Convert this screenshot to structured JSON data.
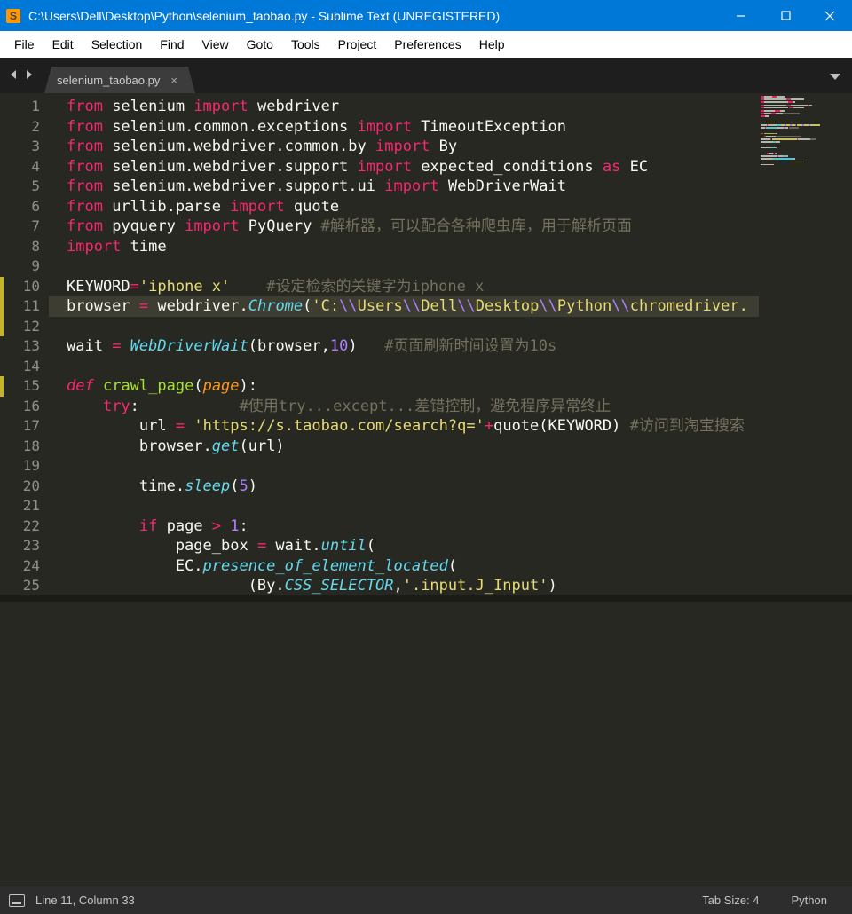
{
  "window": {
    "title": "C:\\Users\\Dell\\Desktop\\Python\\selenium_taobao.py - Sublime Text (UNREGISTERED)"
  },
  "menu": {
    "items": [
      "File",
      "Edit",
      "Selection",
      "Find",
      "View",
      "Goto",
      "Tools",
      "Project",
      "Preferences",
      "Help"
    ]
  },
  "tabs": {
    "active": {
      "label": "selenium_taobao.py",
      "close": "×"
    }
  },
  "editor": {
    "modified_lines": [
      10,
      11,
      12,
      15
    ],
    "current_line": 11,
    "lines": [
      {
        "n": 1,
        "tokens": [
          [
            "from",
            "c-kw"
          ],
          [
            " selenium ",
            ""
          ],
          [
            "import",
            "c-kw"
          ],
          [
            " webdriver",
            ""
          ]
        ]
      },
      {
        "n": 2,
        "tokens": [
          [
            "from",
            "c-kw"
          ],
          [
            " selenium.common.exceptions ",
            ""
          ],
          [
            "import",
            "c-kw"
          ],
          [
            " TimeoutException",
            ""
          ]
        ]
      },
      {
        "n": 3,
        "tokens": [
          [
            "from",
            "c-kw"
          ],
          [
            " selenium.webdriver.common.by ",
            ""
          ],
          [
            "import",
            "c-kw"
          ],
          [
            " By",
            ""
          ]
        ]
      },
      {
        "n": 4,
        "tokens": [
          [
            "from",
            "c-kw"
          ],
          [
            " selenium.webdriver.support ",
            ""
          ],
          [
            "import",
            "c-kw"
          ],
          [
            " expected_conditions ",
            ""
          ],
          [
            "as",
            "c-kw"
          ],
          [
            " EC",
            ""
          ]
        ]
      },
      {
        "n": 5,
        "tokens": [
          [
            "from",
            "c-kw"
          ],
          [
            " selenium.webdriver.support.ui ",
            ""
          ],
          [
            "import",
            "c-kw"
          ],
          [
            " WebDriverWait",
            ""
          ]
        ]
      },
      {
        "n": 6,
        "tokens": [
          [
            "from",
            "c-kw"
          ],
          [
            " urllib.parse ",
            ""
          ],
          [
            "import",
            "c-kw"
          ],
          [
            " quote",
            ""
          ]
        ]
      },
      {
        "n": 7,
        "tokens": [
          [
            "from",
            "c-kw"
          ],
          [
            " pyquery ",
            ""
          ],
          [
            "import",
            "c-kw"
          ],
          [
            " PyQuery ",
            ""
          ],
          [
            "#解析器，可以配合各种爬虫库，用于解析页面",
            "c-com"
          ]
        ]
      },
      {
        "n": 8,
        "tokens": [
          [
            "import",
            "c-kw"
          ],
          [
            " time",
            ""
          ]
        ]
      },
      {
        "n": 9,
        "tokens": [
          [
            "",
            ""
          ]
        ]
      },
      {
        "n": 10,
        "tokens": [
          [
            "KEYWORD",
            ""
          ],
          [
            "=",
            "c-op"
          ],
          [
            "'iphone x'",
            "c-str"
          ],
          [
            "    ",
            ""
          ],
          [
            "#设定检索的关键字为iphone x",
            "c-com"
          ]
        ]
      },
      {
        "n": 11,
        "tokens": [
          [
            "browser ",
            ""
          ],
          [
            "=",
            "c-op"
          ],
          [
            " webdriver.",
            ""
          ],
          [
            "Chrome",
            "c-fn"
          ],
          [
            "(",
            ""
          ],
          [
            "'C:",
            "c-str"
          ],
          [
            "\\\\",
            "c-num"
          ],
          [
            "Users",
            "c-str"
          ],
          [
            "\\\\",
            "c-num"
          ],
          [
            "Dell",
            "c-str"
          ],
          [
            "\\\\",
            "c-num"
          ],
          [
            "Desktop",
            "c-str"
          ],
          [
            "\\\\",
            "c-num"
          ],
          [
            "Python",
            "c-str"
          ],
          [
            "\\\\",
            "c-num"
          ],
          [
            "chromedriver.",
            "c-str"
          ]
        ]
      },
      {
        "n": 12,
        "tokens": [
          [
            "wait ",
            ""
          ],
          [
            "=",
            "c-op"
          ],
          [
            " ",
            ""
          ],
          [
            "WebDriverWait",
            "c-fn"
          ],
          [
            "(browser,",
            ""
          ],
          [
            "10",
            "c-num"
          ],
          [
            ")   ",
            ""
          ],
          [
            "#页面刷新时间设置为10s",
            "c-com"
          ]
        ]
      },
      {
        "n": 13,
        "tokens": [
          [
            "",
            ""
          ]
        ]
      },
      {
        "n": 14,
        "tokens": [
          [
            "def",
            "c-kw-i"
          ],
          [
            " ",
            ""
          ],
          [
            "crawl_page",
            "c-def"
          ],
          [
            "(",
            ""
          ],
          [
            "page",
            "c-arg"
          ],
          [
            "):",
            ""
          ]
        ]
      },
      {
        "n": 15,
        "tokens": [
          [
            "    ",
            ""
          ],
          [
            "try",
            "c-kw"
          ],
          [
            ":           ",
            ""
          ],
          [
            "#使用try...except...差错控制，避免程序异常终止",
            "c-com"
          ]
        ]
      },
      {
        "n": 16,
        "tokens": [
          [
            "        url ",
            ""
          ],
          [
            "=",
            "c-op"
          ],
          [
            " ",
            ""
          ],
          [
            "'https://s.taobao.com/search?q='",
            "c-str"
          ],
          [
            "+",
            "c-op"
          ],
          [
            "quote(KEYWORD) ",
            ""
          ],
          [
            "#访问到淘宝搜索",
            "c-com"
          ]
        ]
      },
      {
        "n": 17,
        "tokens": [
          [
            "        browser.",
            ""
          ],
          [
            "get",
            "c-attr"
          ],
          [
            "(url)",
            ""
          ]
        ]
      },
      {
        "n": 18,
        "tokens": [
          [
            "",
            ""
          ]
        ]
      },
      {
        "n": 19,
        "tokens": [
          [
            "        time.",
            ""
          ],
          [
            "sleep",
            "c-attr"
          ],
          [
            "(",
            ""
          ],
          [
            "5",
            "c-num"
          ],
          [
            ")",
            ""
          ]
        ]
      },
      {
        "n": 20,
        "tokens": [
          [
            "",
            ""
          ]
        ]
      },
      {
        "n": 21,
        "tokens": [
          [
            "        ",
            ""
          ],
          [
            "if",
            "c-kw"
          ],
          [
            " page ",
            ""
          ],
          [
            ">",
            "c-op"
          ],
          [
            " ",
            ""
          ],
          [
            "1",
            "c-num"
          ],
          [
            ":",
            ""
          ]
        ]
      },
      {
        "n": 22,
        "tokens": [
          [
            "            page_box ",
            ""
          ],
          [
            "=",
            "c-op"
          ],
          [
            " wait.",
            ""
          ],
          [
            "until",
            "c-attr"
          ],
          [
            "(",
            ""
          ]
        ]
      },
      {
        "n": 23,
        "tokens": [
          [
            "            EC.",
            ""
          ],
          [
            "presence_of_element_located",
            "c-attr"
          ],
          [
            "(",
            ""
          ]
        ]
      },
      {
        "n": 24,
        "tokens": [
          [
            "                    (By.",
            ""
          ],
          [
            "CSS_SELECTOR",
            "c-attr"
          ],
          [
            ",",
            ""
          ],
          [
            "'.input.J_Input'",
            "c-str"
          ],
          [
            ")",
            ""
          ]
        ]
      },
      {
        "n": 25,
        "tokens": [
          [
            "                )",
            ""
          ]
        ]
      }
    ]
  },
  "statusbar": {
    "cursor": "Line 11, Column 33",
    "tab_size": "Tab Size: 4",
    "syntax": "Python"
  },
  "colors": {
    "titlebar": "#0078d7",
    "editor_bg": "#272822",
    "keyword": "#f92672",
    "string": "#e6db74",
    "number": "#ae81ff",
    "comment": "#75715e",
    "func": "#66d9ef",
    "def": "#a6e22e",
    "arg": "#fd971f"
  }
}
